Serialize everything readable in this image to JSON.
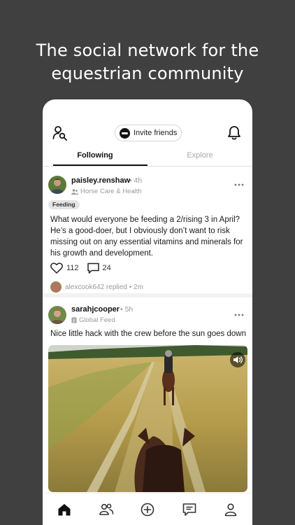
{
  "headline": {
    "line1": "The social network for the",
    "line2": "equestrian community"
  },
  "header": {
    "invite_label": "Invite friends",
    "icons": [
      "user-search-icon",
      "brand-logo-icon",
      "bell-icon"
    ]
  },
  "tabs": [
    {
      "label": "Following",
      "active": true
    },
    {
      "label": "Explore",
      "active": false
    }
  ],
  "posts": [
    {
      "username": "paisley.renshaw",
      "time": "• 4h",
      "group": "Horse Care & Health",
      "tag": "Feeding",
      "text": "What would everyone be feeding a 2/rising 3 in April? He’s a good-doer, but I obviously don’t want to risk missing out on any essential vitamins and minerals for his growth and development.",
      "likes": "112",
      "comments": "24",
      "reply": "alexcook642 replied • 2m"
    },
    {
      "username": "sarahjcooper",
      "time": "• 5h",
      "group": "Global Feed",
      "text": "Nice little hack with the crew before the sun goes down"
    }
  ],
  "bottom_nav": [
    "home-icon",
    "people-icon",
    "add-post-icon",
    "messages-icon",
    "profile-icon"
  ],
  "colors": {
    "background": "#404040",
    "card": "#ffffff",
    "text": "#1a1a1a",
    "muted": "#9a9a9a",
    "tag_bg": "#e4e4e4"
  }
}
